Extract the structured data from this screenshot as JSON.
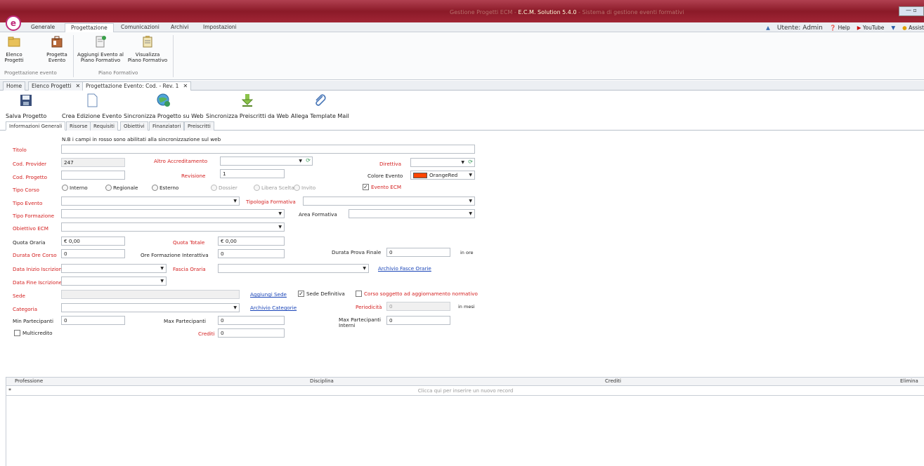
{
  "window": {
    "title_prefix": "Gestione Progetti ECM - ",
    "title": "E.C.M. Solution 5.4.0",
    "title_suffix": " - Sistema di gestione eventi formativi",
    "controls": "— ▫"
  },
  "menu": {
    "tabs": [
      "Generale",
      "Progettazione",
      "Comunicazioni",
      "Archivi",
      "Impostazioni"
    ],
    "user_label": "Utente: Admin",
    "help": "Help",
    "youtube": "YouTube",
    "assist": "Assist"
  },
  "ribbon": {
    "elenco_progetti": "Elenco\nProgetti",
    "progetta_evento": "Progetta\nEvento",
    "aggiungi_evento": "Aggiungi Evento al\nPiano Formativo",
    "visualizza_piano": "Visualizza\nPiano Formativo",
    "group1": "Progettazione evento",
    "group2": "Piano Formativo"
  },
  "doctabs": {
    "home": "Home",
    "elenco": "Elenco Progetti",
    "progettazione": "Progettazione Evento: Cod.  - Rev. 1"
  },
  "toolbar": {
    "salva": "Salva Progetto",
    "crea": "Crea Edizione Evento",
    "sincronizza": "Sincronizza Progetto su Web",
    "sincronizza_preiscritti": "Sincronizza Preiscritti da Web",
    "allega": "Allega Template Mail"
  },
  "subtabs": [
    "Informazioni Generali",
    "Risorse",
    "Requisiti",
    "Obiettivi",
    "Finanziatori",
    "Preiscritti"
  ],
  "form": {
    "note": "N.B i campi in rosso sono abilitati alla sincronizzazione sul web",
    "titolo": "Titolo",
    "cod_provider": "Cod. Provider",
    "cod_provider_value": "247",
    "altro_accreditamento": "Altro Accreditamento",
    "direttiva": "Direttiva",
    "cod_progetto": "Cod. Progetto",
    "revisione": "Revisione",
    "revisione_value": "1",
    "colore_evento": "Colore Evento",
    "colore_evento_value": "OrangeRed",
    "tipo_corso": "Tipo Corso",
    "interno": "Interno",
    "regionale": "Regionale",
    "esterno": "Esterno",
    "dossier": "Dossier",
    "libera_scelta": "Libera Scelta",
    "invito": "Invito",
    "evento_ecm": "Evento ECM",
    "tipo_evento": "Tipo Evento",
    "tipologia_formativa": "Tipologia Formativa",
    "tipo_formazione": "Tipo Formazione",
    "area_formativa": "Area Formativa",
    "obiettivo_ecm": "Obiettivo ECM",
    "quota_oraria": "Quota Oraria",
    "quota_oraria_value": "€ 0,00",
    "quota_totale": "Quota Totale",
    "quota_totale_value": "€ 0,00",
    "durata_ore_corso": "Durata Ore Corso",
    "durata_ore_corso_value": "0",
    "ore_formazione_interattiva": "Ore Formazione Interattiva",
    "ore_formazione_interattiva_value": "0",
    "durata_prova_finale": "Durata Prova Finale",
    "durata_prova_finale_value": "0",
    "in_ore": "in ore",
    "data_inizio_iscrizione": "Data Inizio Iscrizione",
    "fascia_oraria": "Fascia Oraria",
    "archivio_fasce_orarie": "Archivio Fasce Orarie",
    "data_fine_iscrizione": "Data Fine Iscrizione",
    "sede": "Sede",
    "aggiungi_sede": "Aggiungi Sede",
    "sede_definitiva": "Sede Definitiva",
    "corso_soggetto": "Corso soggetto ad aggiornamento normativo",
    "categoria": "Categoria",
    "archivio_categorie": "Archivio Categorie",
    "periodicita": "Periodicità",
    "periodicita_value": "0",
    "in_mesi": "in mesi",
    "min_partecipanti": "Min Partecipanti",
    "min_partecipanti_value": "0",
    "max_partecipanti": "Max Partecipanti",
    "max_partecipanti_value": "0",
    "max_partecipanti_interni": "Max Partecipanti\nInterni",
    "max_partecipanti_interni_value": "0",
    "multicredito": "Multicredito",
    "crediti": "Crediti",
    "crediti_value": "0"
  },
  "grid": {
    "columns": [
      "Professione",
      "Disciplina",
      "Crediti",
      "Elimina"
    ],
    "new_row_hint": "Clicca qui per inserire un nuovo record",
    "new_row_marker": "*"
  }
}
